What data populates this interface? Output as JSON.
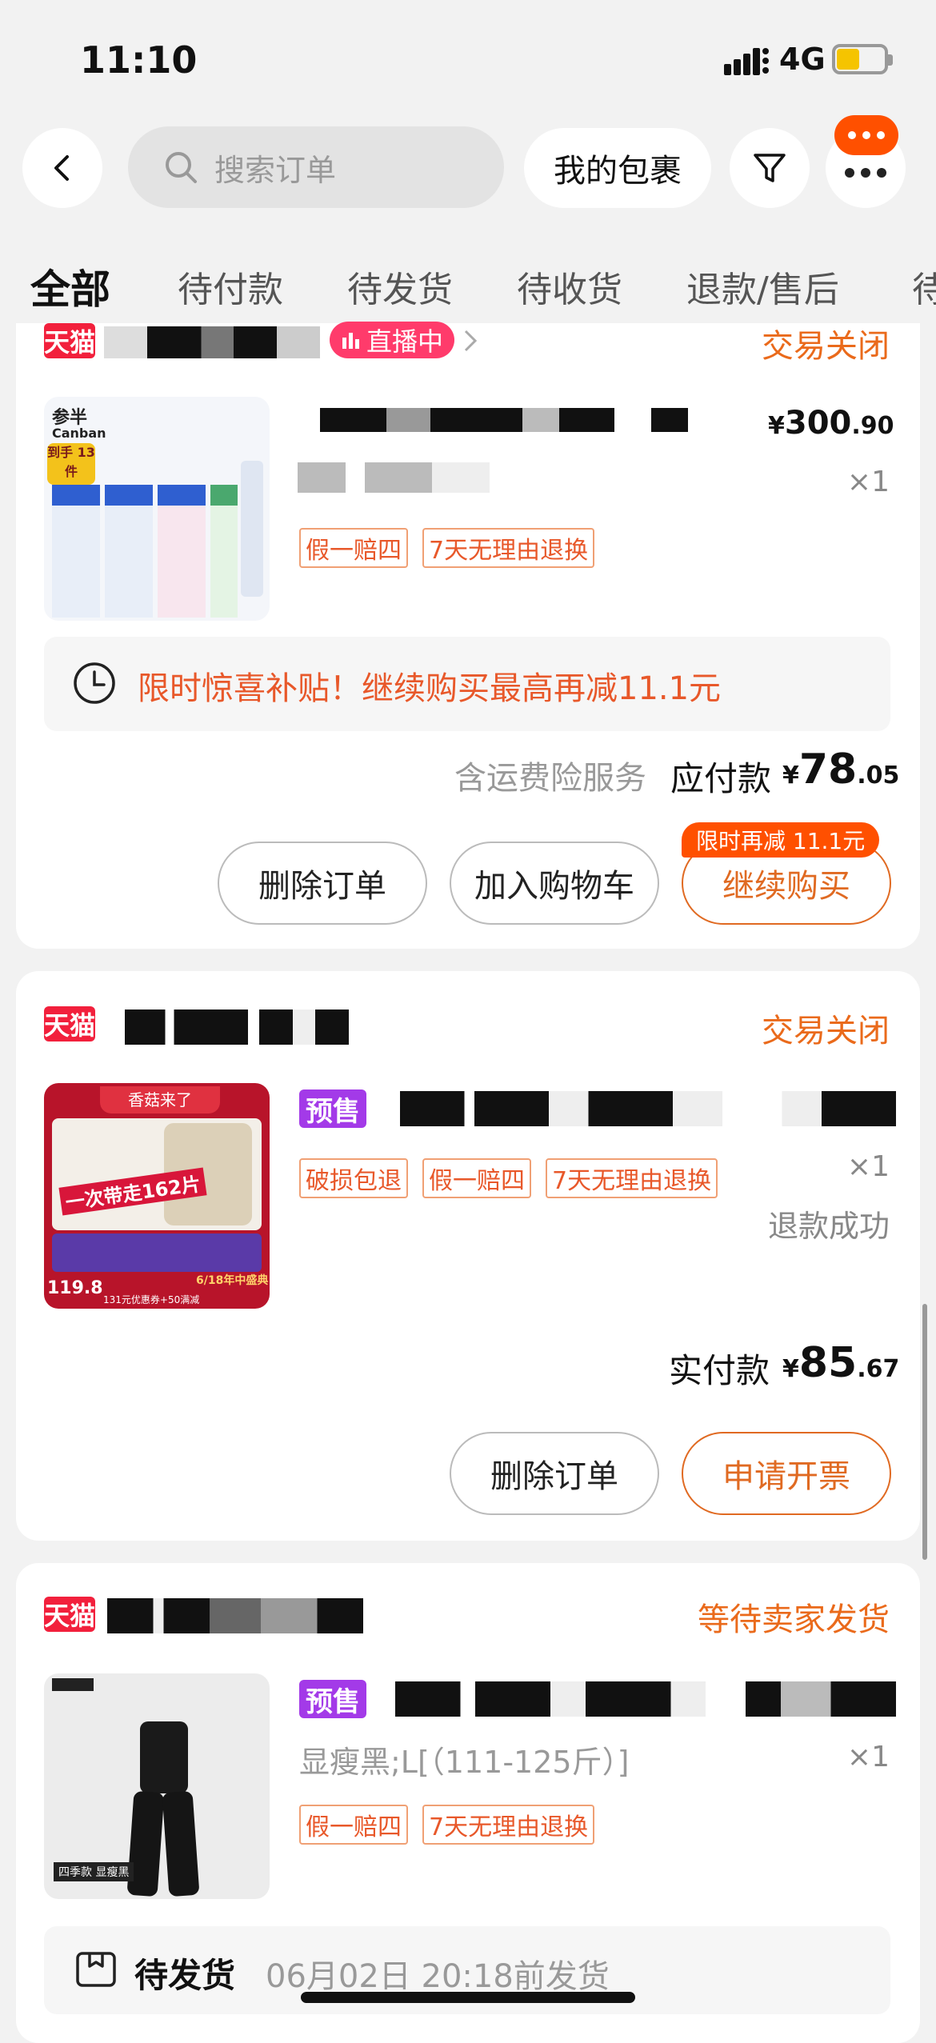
{
  "status_bar": {
    "time": "11:10",
    "network": "4G"
  },
  "header": {
    "search_placeholder": "搜索订单",
    "my_packages": "我的包裹"
  },
  "tabs": [
    {
      "label": "全部",
      "active": true
    },
    {
      "label": "待付款"
    },
    {
      "label": "待发货"
    },
    {
      "label": "待收货"
    },
    {
      "label": "退款/售后"
    },
    {
      "label": "待"
    }
  ],
  "orders": [
    {
      "badge": "天猫",
      "live": "直播中",
      "status": "交易关闭",
      "price_yen": "¥",
      "price_int": "300",
      "price_dec": ".90",
      "qty": "×1",
      "tags": [
        "假一赔四",
        "7天无理由退换"
      ],
      "promo": "限时惊喜补贴！继续购买最高再减11.1元",
      "service": "含运费险服务",
      "pay_label": "应付款",
      "pay_int": "78",
      "pay_dec": ".05",
      "buttons": [
        "删除订单",
        "加入购物车",
        "继续购买"
      ],
      "button_badge": "限时再减 11.1元",
      "thumb": {
        "brand": "参半",
        "brand_en": "Canban",
        "corner": "到手 13件"
      }
    },
    {
      "badge": "天猫",
      "status": "交易关闭",
      "presale": "预售",
      "tags": [
        "破损包退",
        "假一赔四",
        "7天无理由退换"
      ],
      "qty": "×1",
      "refund": "退款成功",
      "pay_label": "实付款",
      "pay_int": "85",
      "pay_dec": ".67",
      "buttons": [
        "删除订单",
        "申请开票"
      ],
      "thumb": {
        "banner": "香菇来了",
        "slogan": "一次带走162片",
        "price": "119.8",
        "event": "6/18年中盛典",
        "coupon": "131元优惠券+50满减"
      }
    },
    {
      "badge": "天猫",
      "status": "等待卖家发货",
      "presale": "预售",
      "sku": "显瘦黑;L[（111-125斤）]",
      "qty": "×1",
      "tags": [
        "假一赔四",
        "7天无理由退换"
      ],
      "ship_label": "待发货",
      "ship_time": "06月02日 20:18前发货",
      "thumb": {
        "label": "四季款 显瘦黑"
      }
    }
  ],
  "colors": {
    "accent": "#ff5000",
    "status_orange": "#ea6a1b",
    "tmall_red": "#f2203c",
    "presale_purple": "#a33ae8"
  }
}
